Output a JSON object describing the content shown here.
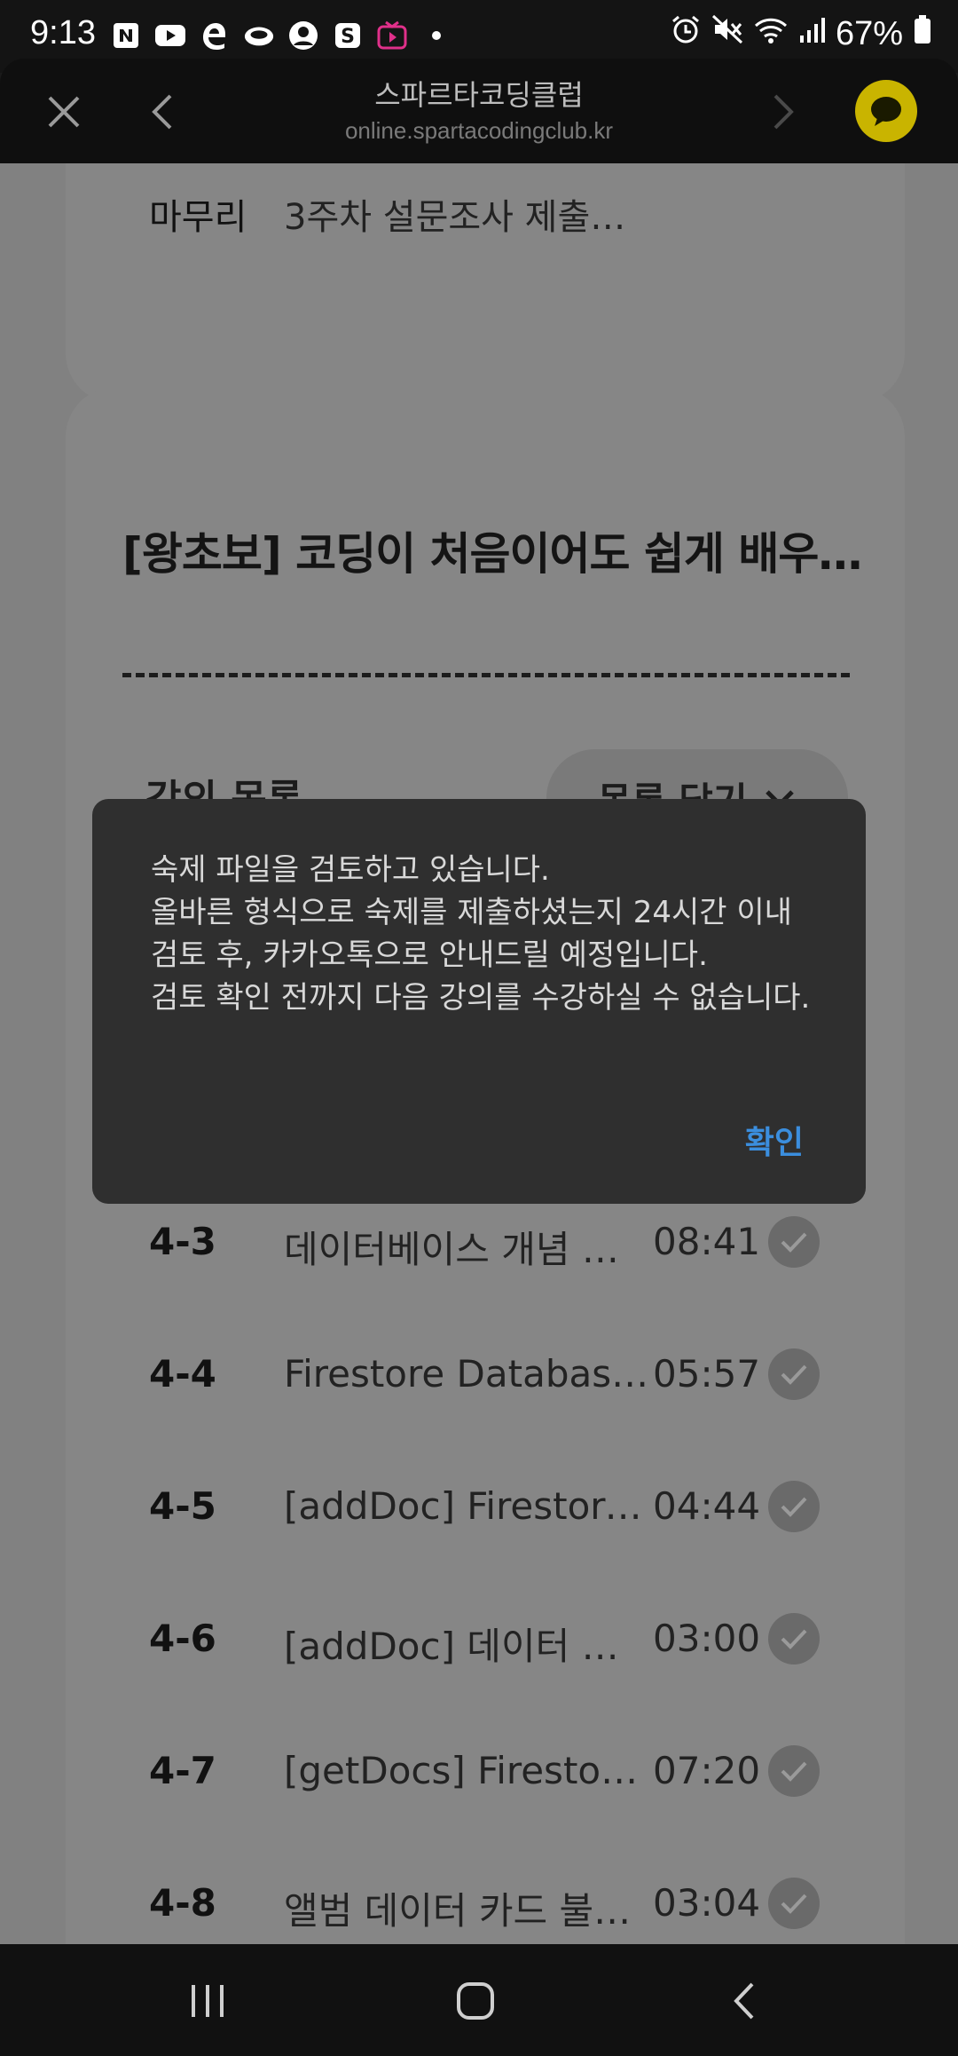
{
  "status_bar": {
    "time": "9:13",
    "battery": "67%",
    "left_icons": [
      "naver-icon",
      "youtube-icon",
      "edge-icon",
      "cloud-icon",
      "profile-icon",
      "s-icon",
      "tv-icon",
      "dot-icon"
    ],
    "right_icons": [
      "alarm-icon",
      "mute-icon",
      "wifi-icon",
      "signal-icon",
      "battery-icon"
    ]
  },
  "browser": {
    "title": "스파르타코딩클럽",
    "url": "online.spartacodingclub.kr"
  },
  "page": {
    "top_row": {
      "label": "마무리",
      "text": "3주차 설문조사 제출…"
    },
    "course_title": "[왕초보] 코딩이 처음이어도 쉽게 배우…",
    "list_title": "강의 목록",
    "toggle_label": "목록 닫기",
    "lectures": [
      {
        "num": "4-3",
        "title": "데이터베이스 개념 이…",
        "time": "08:41"
      },
      {
        "num": "4-4",
        "title": "Firestore Database…",
        "time": "05:57"
      },
      {
        "num": "4-5",
        "title": "[addDoc] Firestore…",
        "time": "04:44"
      },
      {
        "num": "4-6",
        "title": "[addDoc] 데이터 넣…",
        "time": "03:00"
      },
      {
        "num": "4-7",
        "title": "[getDocs] Firestore…",
        "time": "07:20"
      },
      {
        "num": "4-8",
        "title": "앨범 데이터 카드 불…",
        "time": "03:04"
      }
    ]
  },
  "dialog": {
    "message": "숙제 파일을 검토하고 있습니다.\n 올바른 형식으로 숙제를 제출하셨는지 24시간 이내 검토 후, 카카오톡으로 안내드릴 예정입니다.\n검토 확인 전까지 다음 강의를 수강하실 수 없습니다.",
    "confirm_label": "확인"
  },
  "colors": {
    "accent": "#3b8ede",
    "kakao": "#c9b400",
    "dialog_bg": "#2f2f2f"
  }
}
